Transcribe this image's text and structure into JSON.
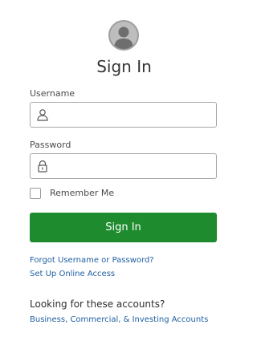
{
  "header": {
    "avatar_icon": "user-avatar-icon",
    "title": "Sign In"
  },
  "form": {
    "username": {
      "label": "Username",
      "value": "",
      "placeholder": "",
      "icon": "user-icon"
    },
    "password": {
      "label": "Password",
      "value": "",
      "placeholder": "",
      "icon": "lock-icon"
    },
    "remember_me": {
      "label": "Remember Me",
      "checked": false
    },
    "submit_label": "Sign In"
  },
  "links": {
    "forgot": "Forgot Username or Password?",
    "setup": "Set Up Online Access"
  },
  "accounts": {
    "heading": "Looking for these accounts?",
    "link": "Business, Commercial, & Investing Accounts"
  },
  "colors": {
    "primary_button": "#1e8b2e",
    "link": "#1f5fa3"
  }
}
